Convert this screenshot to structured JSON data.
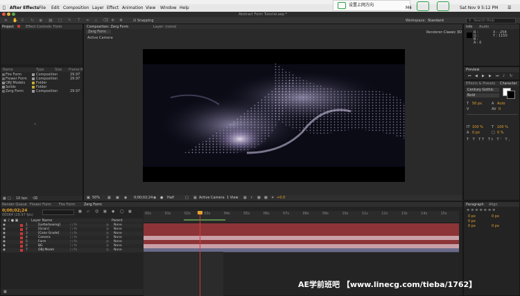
{
  "menubar": {
    "app_name": "After Effects",
    "items": [
      "File",
      "Edit",
      "Composition",
      "Layer",
      "Effect",
      "Animation",
      "View",
      "Window",
      "Help"
    ],
    "overlay_text": "设置上网方向",
    "status_right": "M4",
    "datetime": "Sat Nov 9  5:12 PM"
  },
  "window": {
    "title": "Abstract Form Tutorial.aep *"
  },
  "toolbar": {
    "snapping_label": "Snapping",
    "workspace_label": "Workspace:",
    "workspace_value": "Standard",
    "search_placeholder": "Search Help"
  },
  "project_panel": {
    "tabs": [
      "Project",
      "Effect Controls: Form"
    ],
    "columns": [
      "Name",
      "Type",
      "Size",
      "Frame Rate"
    ],
    "items": [
      {
        "name": "Fire Form",
        "type": "Composition",
        "rate": "29.97"
      },
      {
        "name": "Flower Form",
        "type": "Composition",
        "rate": "29.97"
      },
      {
        "name": "OBJ Models",
        "type": "Folder",
        "rate": ""
      },
      {
        "name": "Solids",
        "type": "Folder",
        "rate": ""
      },
      {
        "name": "Zerg Form",
        "type": "Composition",
        "rate": "29.97"
      }
    ],
    "bpc": "16 bpc"
  },
  "comp_panel": {
    "tabs": [
      "Composition: Zerg Form",
      "Layer: (none)"
    ],
    "sub_tab": "Zerg Form",
    "renderer_label": "Renderer:",
    "renderer_value": "Classic 3D",
    "camera_label": "Active Camera",
    "footer": {
      "zoom": "50%",
      "timecode": "0;00;02;24",
      "resolution": "Half",
      "view": "Active Camera",
      "views": "1 View",
      "exposure": "+0.0"
    }
  },
  "info_panel": {
    "tabs": [
      "Info",
      "Audio"
    ],
    "r_label": "R :",
    "g_label": "G :",
    "b_label": "B :",
    "a_label": "A : 0",
    "x_value": "X : -258",
    "y_value": "Y : 1150"
  },
  "preview_panel": {
    "tab": "Preview"
  },
  "effects_panel": {
    "tabs": [
      "Effects & Presets",
      "Character"
    ],
    "font_family": "Century Gothic",
    "font_style": "Bold",
    "size": "50 px",
    "leading": "Auto",
    "tracking": "0",
    "scale_v": "100 %",
    "scale_h": "100 %",
    "baseline": "0 px",
    "tsume": "0 %"
  },
  "paragraph_panel": {
    "tabs": [
      "Paragraph",
      "Align"
    ],
    "values": [
      "0 px",
      "0 px",
      "0 px",
      "0 px",
      "0 px"
    ]
  },
  "timeline": {
    "tabs": [
      "Render Queue",
      "Flower Form",
      "Fire Form",
      "Zerg Form"
    ],
    "timecode": "0;00;02;24",
    "timecode_sub": "00084 (29.97 fps)",
    "search_placeholder": "",
    "header": {
      "layer_name": "Layer Name",
      "parent": "Parent"
    },
    "ruler": [
      "00s",
      "01s",
      "02s",
      "03s",
      "04s",
      "05s",
      "06s",
      "07s",
      "08s",
      "09s",
      "10s",
      "11s",
      "12s",
      "13s",
      "14s",
      "15s"
    ],
    "layers": [
      {
        "num": "1",
        "name": "[Letterboxing]",
        "parent": "None",
        "color": "#c8393a"
      },
      {
        "num": "2",
        "name": "[Grain]",
        "parent": "None",
        "color": "#c8393a"
      },
      {
        "num": "3",
        "name": "[Color Grade]",
        "parent": "None",
        "color": "#c8393a"
      },
      {
        "num": "4",
        "name": "Camera",
        "parent": "None",
        "color": "#c8393a"
      },
      {
        "num": "5",
        "name": "Form",
        "parent": "None",
        "color": "#c8393a"
      },
      {
        "num": "6",
        "name": "BG",
        "parent": "None",
        "color": "#c8393a"
      },
      {
        "num": "7",
        "name": "OBJ Model",
        "parent": "None",
        "color": "#c8393a"
      }
    ],
    "parent_none": "None"
  },
  "watermark": "AE学前班吧 【www.linecg.com/tieba/1762】",
  "colors": {
    "accent": "#e8a42c",
    "track_red": "#8c3437",
    "track_pink": "#c9a0a8",
    "track_slate": "#6a6a8a",
    "playhead": "#d83a3a"
  }
}
